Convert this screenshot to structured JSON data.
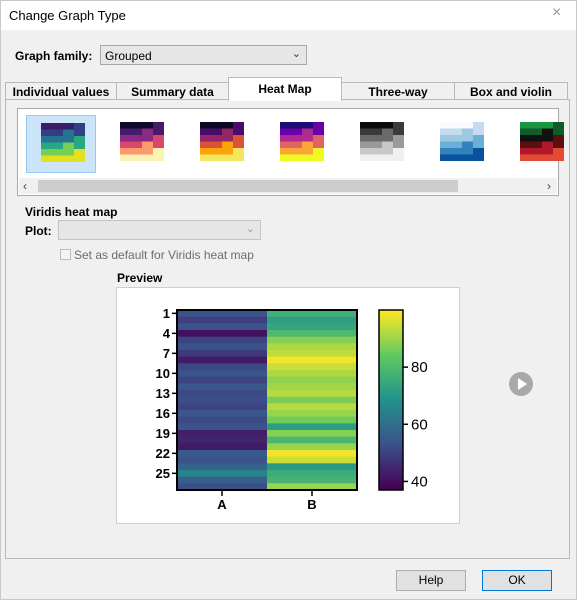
{
  "window": {
    "title": "Change Graph Type",
    "close_glyph": "×"
  },
  "graph_family": {
    "label": "Graph family:",
    "value": "Grouped"
  },
  "tabs": [
    {
      "label": "Individual values",
      "active": false
    },
    {
      "label": "Summary data",
      "active": false
    },
    {
      "label": "Heat Map",
      "active": true
    },
    {
      "label": "Three-way",
      "active": false
    },
    {
      "label": "Box and violin",
      "active": false
    }
  ],
  "gallery": {
    "selected_index": 0,
    "thumbnails": [
      {
        "name": "viridis-heatmap-thumb",
        "colors": [
          "#3b1a66",
          "#323f87",
          "#25738e",
          "#27a883",
          "#74d055",
          "#e3e020"
        ]
      },
      {
        "name": "magma-heatmap-thumb",
        "colors": [
          "#0d0a2b",
          "#481a6b",
          "#8c2981",
          "#d94869",
          "#fd9a6b",
          "#fcf2b4"
        ]
      },
      {
        "name": "inferno-heatmap-thumb",
        "colors": [
          "#0b0724",
          "#4a0c6b",
          "#932667",
          "#dd513a",
          "#fba40a",
          "#f5e65f"
        ]
      },
      {
        "name": "plasma-heatmap-thumb",
        "colors": [
          "#1b0c76",
          "#6a00a8",
          "#b12a90",
          "#e16462",
          "#fca636",
          "#f0f921"
        ]
      },
      {
        "name": "grayscale-heatmap-thumb",
        "colors": [
          "#0a0a0a",
          "#3a3a3a",
          "#6a6a6a",
          "#9a9a9a",
          "#c8c8c8",
          "#f0f0f0"
        ]
      },
      {
        "name": "blues-heatmap-thumb",
        "colors": [
          "#f7fbff",
          "#c6dbef",
          "#9ecae1",
          "#6baed6",
          "#3182bd",
          "#08519c"
        ]
      },
      {
        "name": "green-black-red-heatmap-thumb",
        "colors": [
          "#1a9641",
          "#0f5c28",
          "#111111",
          "#5c0f0f",
          "#b2182b",
          "#e34a33"
        ]
      }
    ],
    "scroll_left": "‹",
    "scroll_right": "›"
  },
  "heatmap_options": {
    "section_title": "Viridis heat map",
    "plot_label": "Plot:",
    "plot_value": "",
    "default_checkbox_label": "Set as default for Viridis heat map",
    "default_checked": false
  },
  "preview": {
    "label": "Preview",
    "chart_data": {
      "type": "heatmap",
      "colormap": "viridis",
      "x_categories": [
        "A",
        "B"
      ],
      "y_tick_labels": [
        "1",
        "4",
        "7",
        "10",
        "13",
        "16",
        "19",
        "22",
        "25"
      ],
      "row_count": 27,
      "colorbar": {
        "ticks": [
          40,
          60,
          80
        ],
        "range": [
          37,
          100
        ]
      },
      "values": {
        "A": [
          53,
          49,
          53,
          40,
          50,
          53,
          48,
          42,
          51,
          53,
          50,
          54,
          51,
          52,
          50,
          54,
          51,
          53,
          43,
          44,
          42,
          55,
          53,
          57,
          65,
          56,
          52
        ],
        "B": [
          77,
          72,
          74,
          80,
          88,
          92,
          94,
          99,
          95,
          92,
          89,
          91,
          93,
          87,
          93,
          90,
          86,
          72,
          88,
          79,
          90,
          99,
          95,
          71,
          76,
          78,
          90
        ]
      }
    }
  },
  "buttons": {
    "help": "Help",
    "ok": "OK",
    "play_icon": "play-icon"
  }
}
